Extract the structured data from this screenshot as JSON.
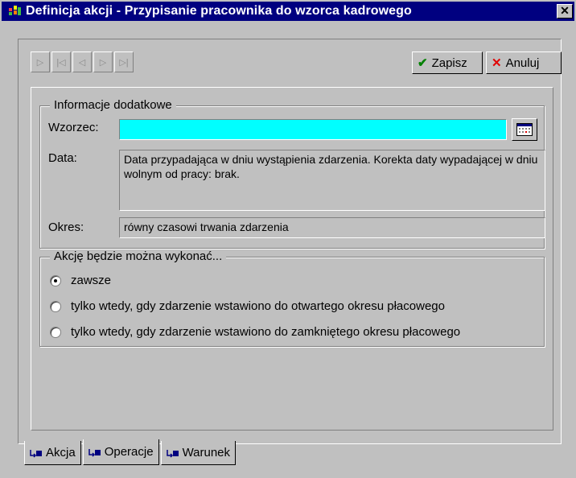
{
  "window": {
    "title": "Definicja akcji - Przypisanie pracownika do wzorca kadrowego",
    "close_glyph": "✕"
  },
  "toolbar": {
    "save_label": "Zapisz",
    "cancel_label": "Anuluj",
    "save_icon": "check-icon",
    "cancel_icon": "x-icon",
    "nav_buttons": [
      "▷",
      "|◁",
      "◁",
      "▷",
      "▷|"
    ]
  },
  "info_group": {
    "legend": "Informacje dodatkowe",
    "wzorzec_label": "Wzorzec:",
    "wzorzec_value": "",
    "data_label": "Data:",
    "data_value": "Data przypadająca w dniu wystąpienia zdarzenia. Korekta daty wypadającej w dniu wolnym od pracy: brak.",
    "okres_label": "Okres:",
    "okres_value": "równy czasowi trwania zdarzenia"
  },
  "action_group": {
    "legend": "Akcję będzie można wykonać...",
    "options": [
      {
        "label": "zawsze",
        "selected": true
      },
      {
        "label": "tylko wtedy, gdy zdarzenie wstawiono do otwartego okresu płacowego",
        "selected": false
      },
      {
        "label": "tylko wtedy, gdy zdarzenie wstawiono do zamkniętego okresu płacowego",
        "selected": false
      }
    ]
  },
  "tabs": [
    {
      "label": "Akcja",
      "active": false
    },
    {
      "label": "Operacje",
      "active": true
    },
    {
      "label": "Warunek",
      "active": false
    }
  ],
  "colors": {
    "titlebar": "#000080",
    "input_highlight": "#00ffff",
    "accent_green": "#008000",
    "accent_red": "#e00000"
  }
}
